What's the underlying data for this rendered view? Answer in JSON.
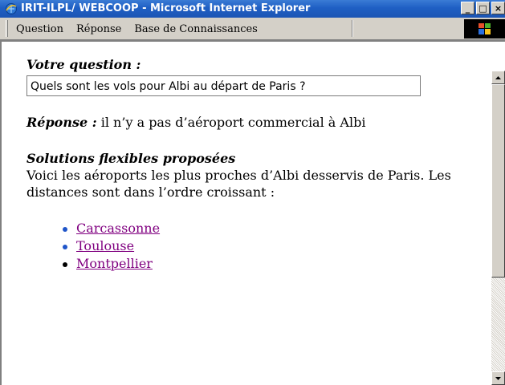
{
  "window": {
    "title": "IRIT-ILPL/ WEBCOOP - Microsoft Internet Explorer",
    "minimize_glyph": "_",
    "maximize_glyph": "□",
    "close_glyph": "×"
  },
  "menubar": {
    "items": [
      {
        "label": "Question"
      },
      {
        "label": "Réponse"
      },
      {
        "label": "Base de Connaissances"
      }
    ]
  },
  "page": {
    "question_heading": "Votre question :",
    "question_value": "Quels sont les vols pour Albi au départ de Paris ?",
    "answer_heading": "Réponse :",
    "answer_text": " il n’y a pas d’aéroport commercial à Albi",
    "solutions_heading": "Solutions flexibles proposées",
    "solutions_desc": "Voici les aéroports les plus proches d’Albi desservis de Paris. Les distances sont dans l’ordre croissant :",
    "airports": [
      {
        "label": "Carcassonne"
      },
      {
        "label": "Toulouse"
      },
      {
        "label": "Montpellier"
      }
    ]
  },
  "colors": {
    "titlebar": "#1f5fc4",
    "link_visited": "#800080",
    "bullet_blue": "#1f55c9"
  },
  "icons": [
    "ie-icon",
    "windows-logo-icon",
    "scroll-up-arrow-icon",
    "scroll-down-arrow-icon"
  ]
}
